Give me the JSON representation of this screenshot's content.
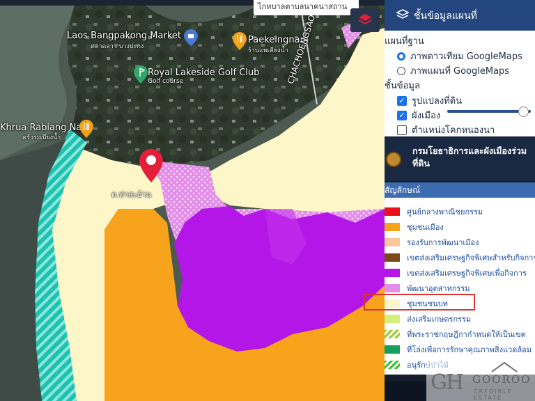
{
  "map": {
    "search_text": "ไกหบาลตาบลนาคนาสถาน",
    "places": [
      {
        "name": "Laos Bangpakong Market",
        "sub": "ตลาดลาว บางปะกง",
        "kind": "shopping"
      },
      {
        "name": "Paekeingnam",
        "sub": "ร้านแพเคียงน้ำ",
        "kind": "food"
      },
      {
        "name": "Royal Lakeside Golf Club",
        "sub": "Golf course",
        "kind": "golf"
      },
      {
        "name": "Khrua Rabiang Nam",
        "sub": "ครัวระเบียงน้ำ",
        "kind": "food"
      },
      {
        "name": "ต.ท่าสะอ้าน",
        "kind": "area"
      }
    ],
    "road_label": "CHACHOENGSAO"
  },
  "panel": {
    "title": "ชั้นข้อมูลแผนที่",
    "base_section": "แผนที่ฐาน",
    "base_options": [
      {
        "label": "ภาพดาวเทียม GoogleMaps",
        "selected": true
      },
      {
        "label": "ภาพแผนที่ GoogleMaps",
        "selected": false
      }
    ],
    "data_section": "ชั้นข้อมูล",
    "data_layers": [
      {
        "label": "รูปแปลงที่ดิน",
        "checked": true
      },
      {
        "label": "ผังเมือง",
        "checked": true
      },
      {
        "label": "ตำแหน่งโคกหนองนา",
        "checked": false
      }
    ],
    "opacity": 0.9,
    "department": "กรมโยธาธิการและผังเมืองร่วม ที่ดิน",
    "legend_title": "สัญลักษณ์",
    "legend": [
      {
        "label": "ศูนย์กลางพาณิชยกรรม",
        "color": "#e8101a"
      },
      {
        "label": "ชุมชนเมือง",
        "color": "#f7a41c"
      },
      {
        "label": "รองรับการพัฒนาเมือง",
        "color": "#f8c89a"
      },
      {
        "label": "เขตส่งเสริมเศรษฐกิจพิเศษสำหรับกิจการ",
        "color": "#7a4a16"
      },
      {
        "label": "เขตส่งเสริมเศรษฐกิจพิเศษเพื่อกิจการ",
        "color": "#b316e6"
      },
      {
        "label": "พัฒนาอุตสาหกรรม",
        "color": "#e08ee8"
      },
      {
        "label": "ชุมชนชนบท",
        "color": "#fdf6c8"
      },
      {
        "label": "ส่งเสริมเกษตรกรรม",
        "color": "#d4f07a"
      },
      {
        "label": "ที่พระราชกฤษฎีกากำหนดให้เป็นเขต",
        "color": "#9acb3c"
      },
      {
        "label": "ที่โล่งเพื่อการรักษาคุณภาพสิ่งแวดล้อม",
        "color": "#12a05a"
      },
      {
        "label": "อนุรักษ์ป่าไม้",
        "color": "#3fc23a"
      }
    ],
    "highlighted": "ชุมชนชนบท"
  },
  "watermark": {
    "mark": "GH",
    "name": "GOOROO",
    "sub": "CREDIBLE ESTATE"
  }
}
